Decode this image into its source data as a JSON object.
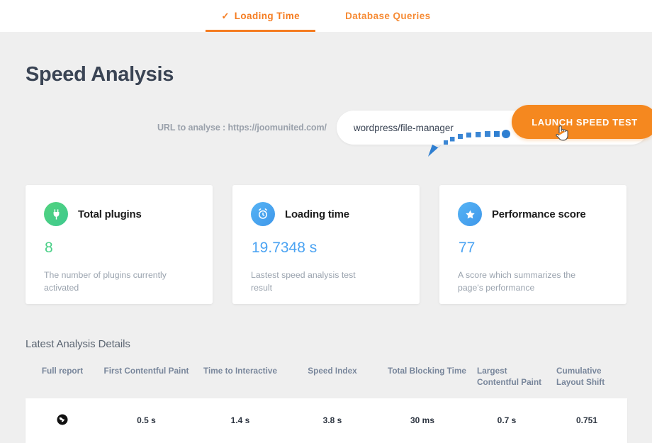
{
  "tabs": [
    {
      "label": "Loading Time",
      "icon": "check-icon",
      "active": true
    },
    {
      "label": "Database Queries",
      "icon": "",
      "active": false
    }
  ],
  "page_title": "Speed Analysis",
  "url_form": {
    "label": "URL to analyse : https://joomunited.com/",
    "input_value": "wordpress/file-manager",
    "input_placeholder": "wordpress/file-manager",
    "button_label": "LAUNCH SPEED TEST"
  },
  "cards": [
    {
      "icon": "plug-icon",
      "title": "Total plugins",
      "value": "8",
      "description": "The number of plugins currently activated",
      "accent": "#4bd088"
    },
    {
      "icon": "alarm-clock-icon",
      "title": "Loading time",
      "value": "19.7348 s",
      "description": "Lastest speed analysis test result",
      "accent": "#4ba3f2"
    },
    {
      "icon": "star-icon",
      "title": "Performance score",
      "value": "77",
      "description": "A score which summarizes the page's performance",
      "accent": "#4ba3f2"
    }
  ],
  "details": {
    "section_title": "Latest Analysis Details",
    "columns": [
      "Full report",
      "First Contentful Paint",
      "Time to Interactive",
      "Speed Index",
      "Total Blocking Time",
      "Largest Contentful Paint",
      "Cumulative Layout Shift"
    ],
    "rows": [
      {
        "full_report_icon": "globe-icon",
        "first_contentful_paint": "0.5 s",
        "time_to_interactive": "1.4 s",
        "speed_index": "3.8 s",
        "total_blocking_time": "30 ms",
        "largest_contentful_paint": "0.7 s",
        "cumulative_layout_shift": "0.751"
      }
    ]
  },
  "annotation": {
    "type": "dotted-arrow",
    "color": "#2f7fd1",
    "points_to": "launch-speed-test-button"
  },
  "colors": {
    "brand_orange": "#f57c20",
    "background": "#efefef",
    "card_background": "#ffffff",
    "title_color": "#3a4454"
  }
}
